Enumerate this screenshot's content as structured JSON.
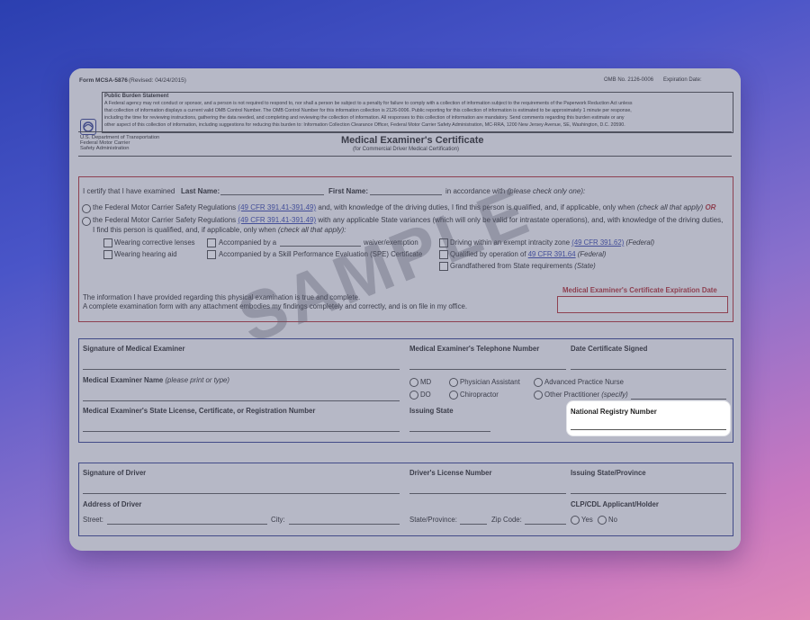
{
  "header": {
    "form_id": "Form MCSA-5876",
    "revised": "(Revised: 04/24/2015)",
    "omb": "OMB No. 2126-0006",
    "expiration": "Expiration Date:"
  },
  "burden": {
    "title": "Public Burden Statement",
    "line1": "A Federal agency may not conduct or sponsor, and a person is not required to respond to, nor shall a person be subject to a penalty for failure to comply with a collection of information subject to the requirements of the Paperwork Reduction Act unless",
    "line2": "that collection of information displays a current valid OMB Control Number. The OMB Control Number for this information collection is 2126-0006. Public reporting for this collection of information is estimated to be approximately 1 minute per response,",
    "line3": "including the time for reviewing instructions, gathering the data needed, and completing and reviewing the collection of information. All responses to this collection of information are mandatory. Send comments regarding this burden estimate or any",
    "line4": "other aspect of this collection of information, including suggestions for reducing this burden to: Information Collection Clearance Officer, Federal Motor Carrier Safety Administration, MC-RRA, 1200 New Jersey Avenue, SE, Washington, D.C. 20590."
  },
  "agency": {
    "line1": "U.S. Department of Transportation",
    "line2": "Federal Motor Carrier",
    "line3": "Safety Administration"
  },
  "title": {
    "main": "Medical Examiner's Certificate",
    "sub": "(for Commercial Driver Medical Certification)"
  },
  "certify": {
    "intro": "I certify that I have examined",
    "last_name": "Last Name:",
    "first_name": "First Name:",
    "accordance": "in accordance with",
    "check_one": "(please check only one):",
    "opt1_pre": "the Federal Motor Carrier Safety Regulations",
    "opt1_link": "(49 CFR 391.41-391.49)",
    "opt1_post": "and, with knowledge of the driving duties, I find this person is qualified, and, if applicable, only when",
    "opt1_check": "(check all that apply)",
    "opt1_or": "OR",
    "opt2_pre": "the Federal Motor Carrier Safety Regulations",
    "opt2_link": "(49 CFR 391.41-391.49)",
    "opt2_post": "with any applicable State variances (which will only be valid for intrastate operations), and, with knowledge of the driving duties,",
    "opt2_line2": "I find this person is qualified, and, if applicable, only when",
    "opt2_check": "(check all that apply):",
    "c1": "Wearing corrective lenses",
    "c2": "Wearing hearing aid",
    "c3_pre": "Accompanied by a",
    "c3_post": "waiver/exemption",
    "c4": "Accompanied by a Skill Performance Evaluation (SPE) Certificate",
    "c5_pre": "Driving within an exempt intracity zone",
    "c5_link": "(49 CFR 391.62)",
    "c5_post": "(Federal)",
    "c6_pre": "Qualified by operation of",
    "c6_link": "49 CFR 391.64",
    "c6_post": "(Federal)",
    "c7_pre": "Grandfathered from State requirements",
    "c7_post": "(State)",
    "info1": "The information I have provided regarding this physical examination is true and complete.",
    "info2": "A complete examination form with any attachment embodies my findings completely and correctly, and is on file in my office.",
    "exp_label": "Medical Examiner's Certificate Expiration Date"
  },
  "examiner": {
    "sig": "Signature of Medical Examiner",
    "phone": "Medical Examiner's Telephone Number",
    "date": "Date Certificate Signed",
    "name": "Medical Examiner Name",
    "name_hint": "(please print or type)",
    "md": "MD",
    "do": "DO",
    "pa": "Physician Assistant",
    "chiro": "Chiropractor",
    "apn": "Advanced Practice Nurse",
    "other": "Other Practitioner",
    "other_hint": "(specify)",
    "license": "Medical Examiner's State License, Certificate, or Registration Number",
    "issuing": "Issuing State",
    "nrn": "National Registry Number"
  },
  "driver": {
    "sig": "Signature of Driver",
    "license": "Driver's License Number",
    "issuing": "Issuing State/Province",
    "address": "Address of Driver",
    "street": "Street:",
    "city": "City:",
    "state": "State/Province:",
    "zip": "Zip Code:",
    "clp": "CLP/CDL Applicant/Holder",
    "yes": "Yes",
    "no": "No"
  },
  "watermark": "SAMPLE",
  "colors": {
    "accent_red": "#b0282d",
    "link_blue": "#2f3fa8",
    "box_blue": "#2d3a8c"
  }
}
